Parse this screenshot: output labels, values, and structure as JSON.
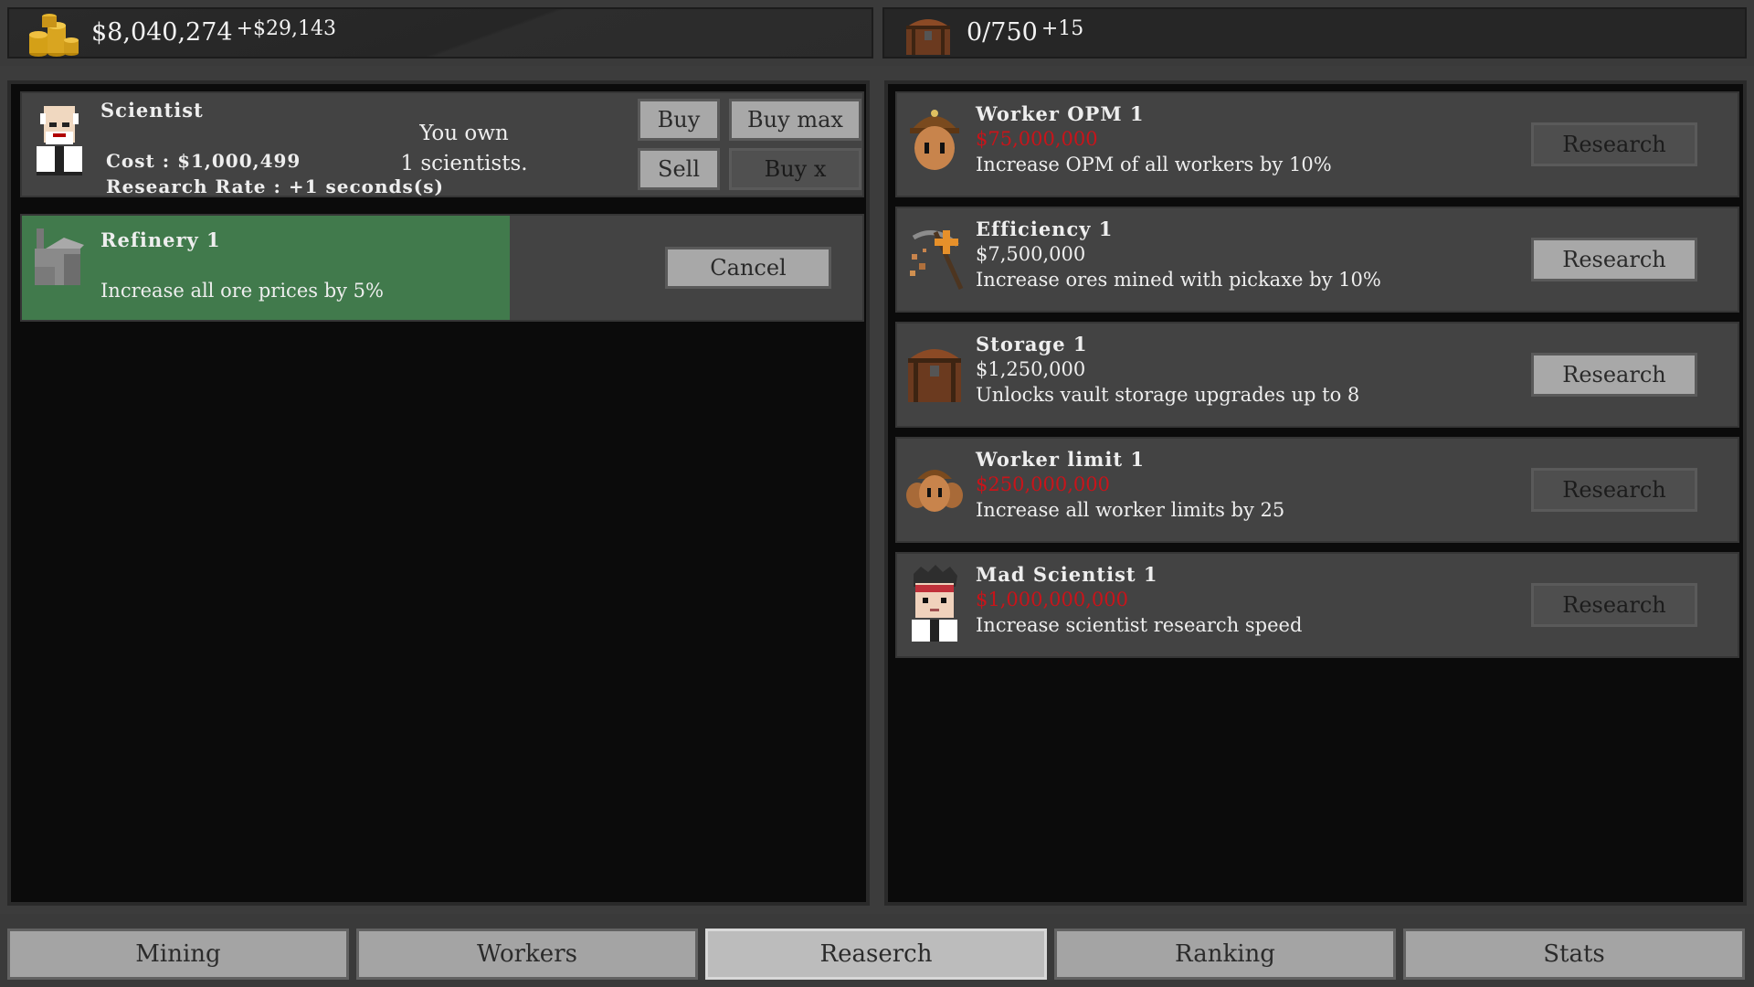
{
  "top_bar": {
    "money": {
      "value": "$8,040,274",
      "delta": "+$29,143",
      "icon": "coin-stack-icon"
    },
    "storage": {
      "value": "0/750",
      "delta": "+15",
      "icon": "treasure-chest-icon"
    }
  },
  "scientist": {
    "name": "Scientist",
    "cost": "Cost : $1,000,499",
    "rate": "Research Rate : +1 seconds(s)",
    "own_line1": "You own",
    "own_line2": "1 scientists.",
    "buttons": {
      "buy": "Buy",
      "buy_max": "Buy max",
      "sell": "Sell",
      "buy_x": "Buy x"
    },
    "icon": "scientist-portrait-icon"
  },
  "active_research": {
    "title": "Refinery 1",
    "description": "Increase all ore prices by 5%",
    "progress": 0.58,
    "cancel_label": "Cancel",
    "icon": "refinery-icon",
    "progress_color": "#417a4c"
  },
  "research_list": [
    {
      "title": "Worker OPM 1",
      "cost": "$75,000,000",
      "affordable": false,
      "description": "Increase OPM of all workers by 10%",
      "button": "Research",
      "icon": "miner-worker-icon"
    },
    {
      "title": "Efficiency 1",
      "cost": "$7,500,000",
      "affordable": true,
      "description": "Increase ores mined with pickaxe by 10%",
      "button": "Research",
      "icon": "pickaxe-plus-icon"
    },
    {
      "title": "Storage 1",
      "cost": "$1,250,000",
      "affordable": true,
      "description": "Unlocks vault storage upgrades up to 8",
      "button": "Research",
      "icon": "treasure-chest-icon"
    },
    {
      "title": "Worker limit 1",
      "cost": "$250,000,000",
      "affordable": false,
      "description": "Increase all worker limits by 25",
      "button": "Research",
      "icon": "worker-group-icon"
    },
    {
      "title": "Mad Scientist 1",
      "cost": "$1,000,000,000",
      "affordable": false,
      "description": "Increase scientist research speed",
      "button": "Research",
      "icon": "mad-scientist-icon"
    }
  ],
  "tabs": [
    {
      "label": "Mining",
      "active": false
    },
    {
      "label": "Workers",
      "active": false
    },
    {
      "label": "Reaserch",
      "active": true
    },
    {
      "label": "Ranking",
      "active": false
    },
    {
      "label": "Stats",
      "active": false
    }
  ],
  "colors": {
    "unaffordable": "#c8141a",
    "progress": "#417a4c"
  }
}
